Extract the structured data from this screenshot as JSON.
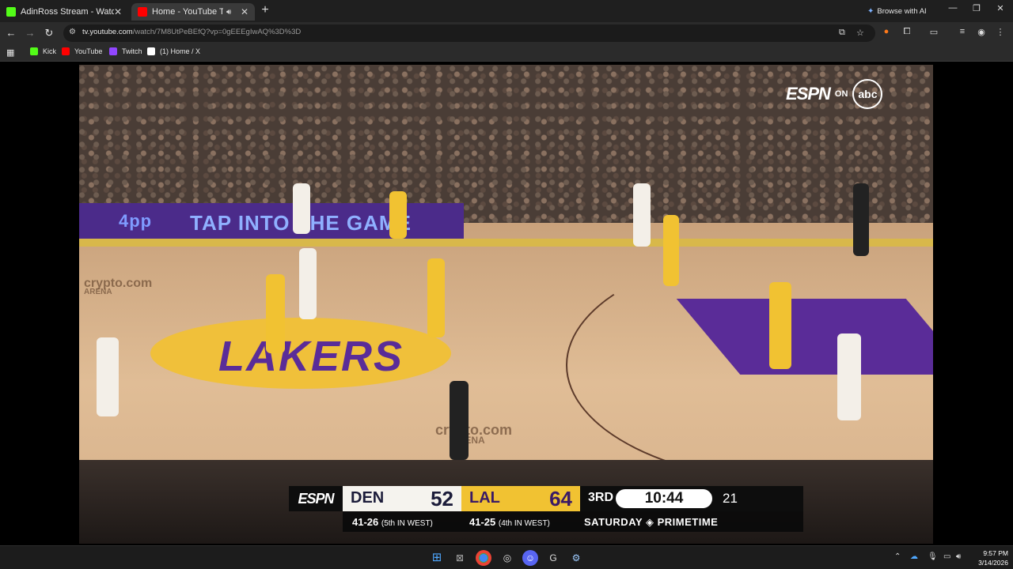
{
  "tabs": [
    {
      "title": "AdinRoss Stream - Watch Live o",
      "favicon": "kick-icon",
      "favicon_color": "#53fc18"
    },
    {
      "title": "Home - YouTube TV",
      "favicon": "youtube-tv-icon",
      "favicon_color": "#ff0000",
      "active": true
    }
  ],
  "window": {
    "browse_ai_label": "Browse with AI",
    "minimize": "—",
    "restore": "❐",
    "close": "✕"
  },
  "toolbar": {
    "url_domain": "tv.youtube.com",
    "url_path": "/watch/7M8UtPeBEfQ?vp=0gEEEgIwAQ%3D%3D"
  },
  "bookmarks": [
    {
      "label": "Kick",
      "color": "#53fc18"
    },
    {
      "label": "YouTube",
      "color": "#ff0000"
    },
    {
      "label": "Twitch",
      "color": "#9146ff"
    },
    {
      "label": "(1) Home / X",
      "color": "#ffffff"
    }
  ],
  "video": {
    "broadcast_network": "ESPN",
    "broadcast_on": "ON",
    "broadcast_partner": "abc",
    "ad_board_text": "TAP INTO THE GAME",
    "ad_board_apps": "4pp",
    "court_logo": "LAKERS",
    "court_sponsor_1": "crypto.com",
    "court_sponsor_1_sub": "ARENA",
    "court_sponsor_2": "crypto.com",
    "court_sponsor_2_sub": "ARENA"
  },
  "scorebug": {
    "network": "ESPN",
    "home": {
      "abbr": "DEN",
      "score": "52",
      "record": "41-26",
      "standing": "(5th IN WEST)"
    },
    "away": {
      "abbr": "LAL",
      "score": "64",
      "record": "41-25",
      "standing": "(4th IN WEST)"
    },
    "period": "3RD",
    "clock": "10:44",
    "shot_clock": "21",
    "promo": "SATURDAY",
    "promo_2": "PRIMETIME"
  },
  "taskbar": {
    "time": "9:57 PM",
    "date": "3/14/2026"
  }
}
